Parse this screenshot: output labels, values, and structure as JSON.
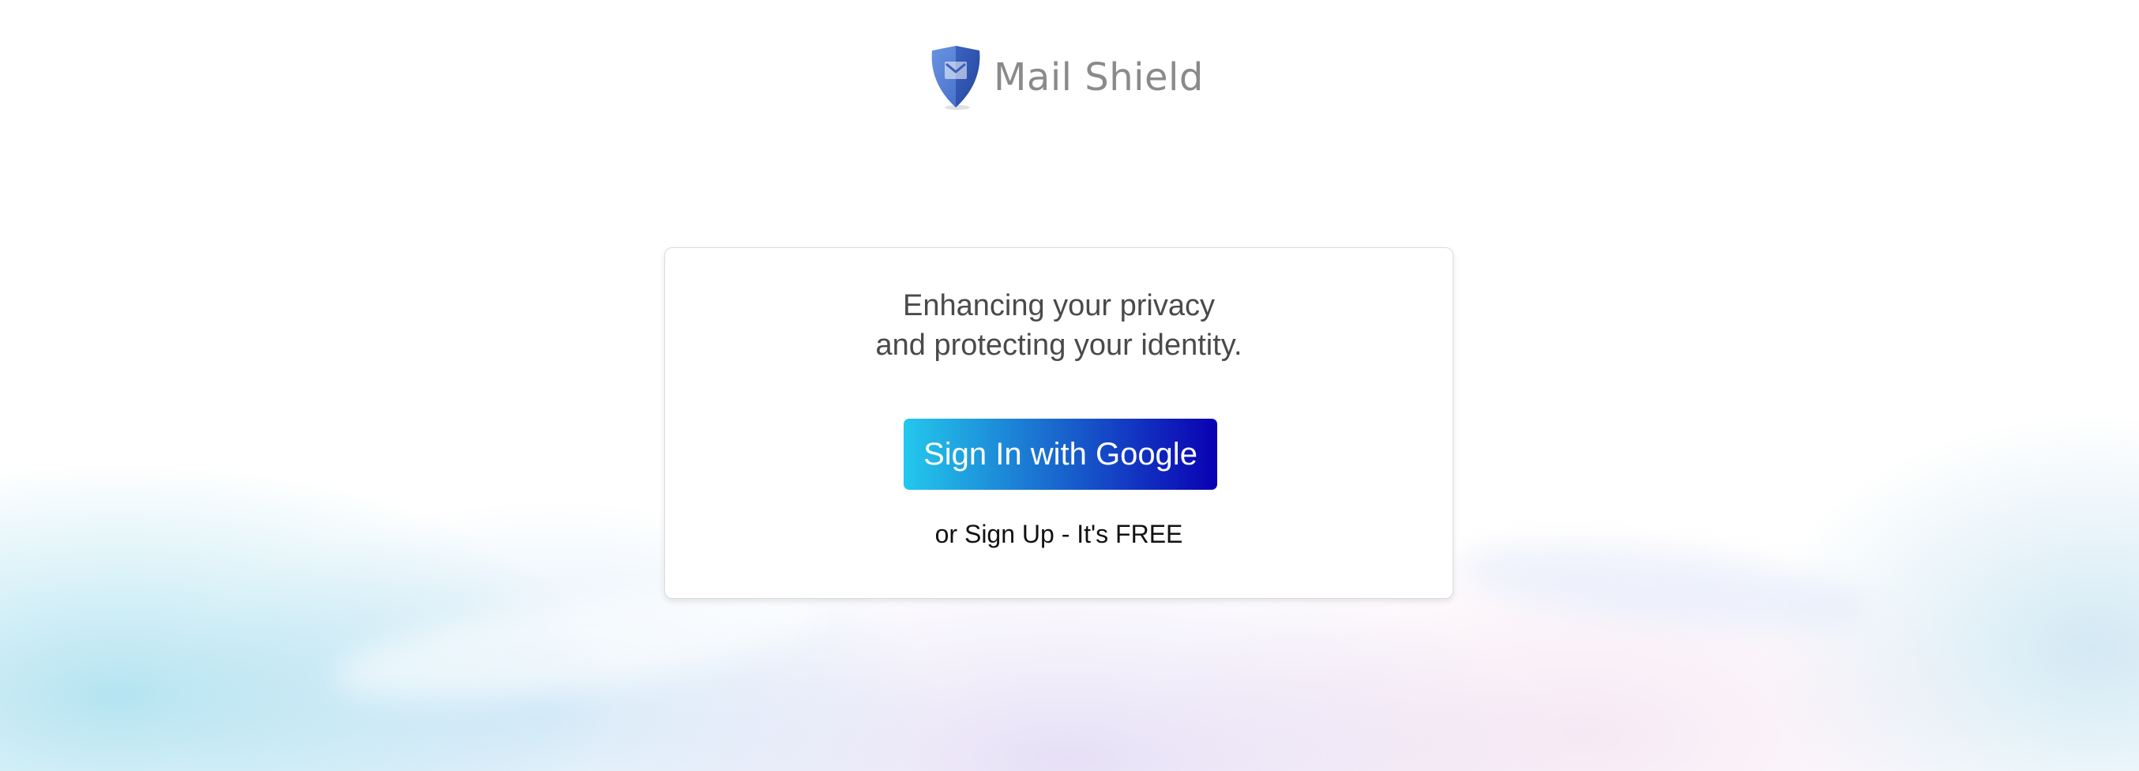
{
  "brand": {
    "name": "Mail Shield",
    "icon": "shield-envelope-icon",
    "colors": {
      "shield_light": "#5d86d6",
      "shield_dark": "#2f58b8",
      "text": "#8a8a8a"
    }
  },
  "card": {
    "tagline_line1": "Enhancing your privacy",
    "tagline_line2": "and protecting your identity.",
    "signin_button_label": "Sign In with Google",
    "signup_link_text": "or Sign Up - It's FREE"
  },
  "colors": {
    "button_gradient_start": "#23c8ec",
    "button_gradient_end": "#0a00b3",
    "card_border": "#dcdcdc"
  }
}
